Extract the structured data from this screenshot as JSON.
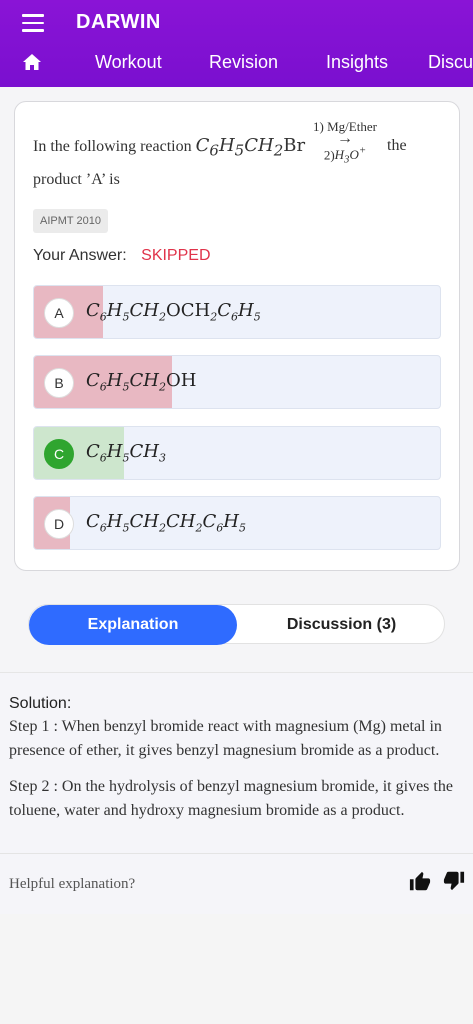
{
  "app": {
    "title": "DARWIN"
  },
  "nav": {
    "tabs": [
      {
        "label": "Workout"
      },
      {
        "label": "Revision"
      },
      {
        "label": "Insights"
      },
      {
        "label": "Discu"
      }
    ]
  },
  "question": {
    "intro": "In the following reaction",
    "reagent_top": "1) Mg/Ether",
    "reagent_bottom": "2)",
    "tail": "the",
    "line2": "product ’A’ is",
    "source_badge": "AIPMT 2010",
    "your_answer_label": "Your Answer:",
    "your_answer_value": "SKIPPED"
  },
  "options": [
    {
      "letter": "A",
      "state": "wrong",
      "fill_fraction": 0.17
    },
    {
      "letter": "B",
      "state": "wrong",
      "fill_fraction": 0.34
    },
    {
      "letter": "C",
      "state": "correct",
      "fill_fraction": 0.22
    },
    {
      "letter": "D",
      "state": "wrong",
      "fill_fraction": 0.09
    }
  ],
  "segmented": {
    "active": "Explanation",
    "inactive": "Discussion (3)"
  },
  "solution": {
    "title": "Solution:",
    "step1": "Step 1 : When benzyl bromide react with magnesium (Mg) metal in presence of ether, it gives benzyl magnesium bromide as a product.",
    "step2": "Step 2 : On the hydrolysis of benzyl magnesium bromide, it gives the toluene, water and hydroxy magnesium bromide as a product."
  },
  "feedback": {
    "prompt": "Helpful explanation?"
  },
  "colors": {
    "header": "#8a14d6",
    "wrong_fill": "#e8b8c2",
    "correct_fill": "#cde6cd",
    "accent_blue": "#2f6bff",
    "skipped": "#e0334a"
  },
  "icons": [
    "menu-icon",
    "home-icon",
    "thumbs-up-icon",
    "thumbs-down-icon"
  ]
}
